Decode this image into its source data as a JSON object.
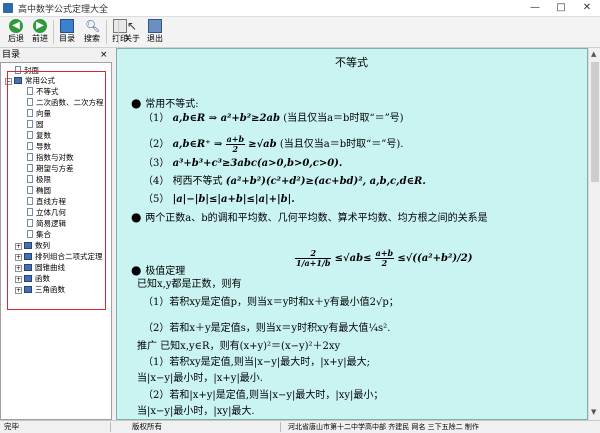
{
  "window": {
    "title": "高中数学公式定理大全",
    "minimize": "—",
    "maximize": "□",
    "close": "✕"
  },
  "toolbar": {
    "back": "后退",
    "forward": "前进",
    "toc": "目录",
    "search": "搜索",
    "print": "打印",
    "about": "关于",
    "exit": "退出"
  },
  "panel": {
    "title": "目录",
    "close": "×"
  },
  "tree": {
    "cover": "封面",
    "group_open": "常用公式",
    "children": [
      "不等式",
      "二次函数、二次方程",
      "向量",
      "圆",
      "复数",
      "导数",
      "指数与对数",
      "期望与方差",
      "极限",
      "椭圆",
      "直线方程",
      "立体几何",
      "简易逻辑",
      "集合"
    ],
    "groups_closed": [
      "数列",
      "排列组合二项式定理",
      "圆锥曲线",
      "函数",
      "三角函数"
    ]
  },
  "content": {
    "heading": "不等式",
    "s1_title": "常用不等式:",
    "l1_num": "（1）",
    "l1_math": "a,b∈R ⇒ a²+b²≥2ab",
    "l1_note": "(当且仅当a＝b时取“＝”号)",
    "l2_num": "（2）",
    "l2_frac_num": "a+b",
    "l2_frac_den": "2",
    "l2_math": "≥√ab",
    "l2_pre": "a,b∈R⁺ ⇒",
    "l2_note": "(当且仅当a＝b时取“＝”号).",
    "l3_num": "（3）",
    "l3_math": "a³+b³+c³≥3abc(a>0,b>0,c>0).",
    "l4_num": "（4）",
    "l4_label": "柯西不等式",
    "l4_math": "(a²+b²)(c²+d²)≥(ac+bd)², a,b,c,d∈R.",
    "l5_num": "（5）",
    "l5_math": "|a|−|b|≤|a+b|≤|a|+|b|.",
    "s2": "两个正数a、b的调和平均数、几何平均数、算术平均数、均方根之间的关系是",
    "mean_formula_left": "2",
    "mean_formula_den": "1/a+1/b",
    "mean_formula_mid": "≤√ab≤",
    "mean_formula_frac_num": "a+b",
    "mean_formula_frac_den": "2",
    "mean_formula_end": "≤√((a²+b²)/2)",
    "s3_title": "极值定理",
    "s3_l1": "已知x,y都是正数，则有",
    "s3_l2": "（1）若积xy是定值p，则当x＝y时和x＋y有最小值2√p；",
    "s3_l3": "（2）若和x＋y是定值s，则当x＝y时积xy有最大值¼s².",
    "s3_l4": "推广  已知x,y∈R，则有(x+y)²＝(x−y)²＋2xy",
    "s3_l5": "（1）若积xy是定值,则当|x−y|最大时，|x+y|最大;",
    "s3_l6": "当|x−y|最小时，|x+y|最小.",
    "s3_l7": "（2）若和|x+y|是定值,则当|x−y|最大时，|xy|最小；",
    "s3_l8": "当|x−y|最小时，|xy|最大."
  },
  "status": {
    "ready": "完毕",
    "copyright": "版权所有",
    "author": "河北省唐山市第十二中学高中部   齐建民   网名  三下五除二  制作"
  }
}
